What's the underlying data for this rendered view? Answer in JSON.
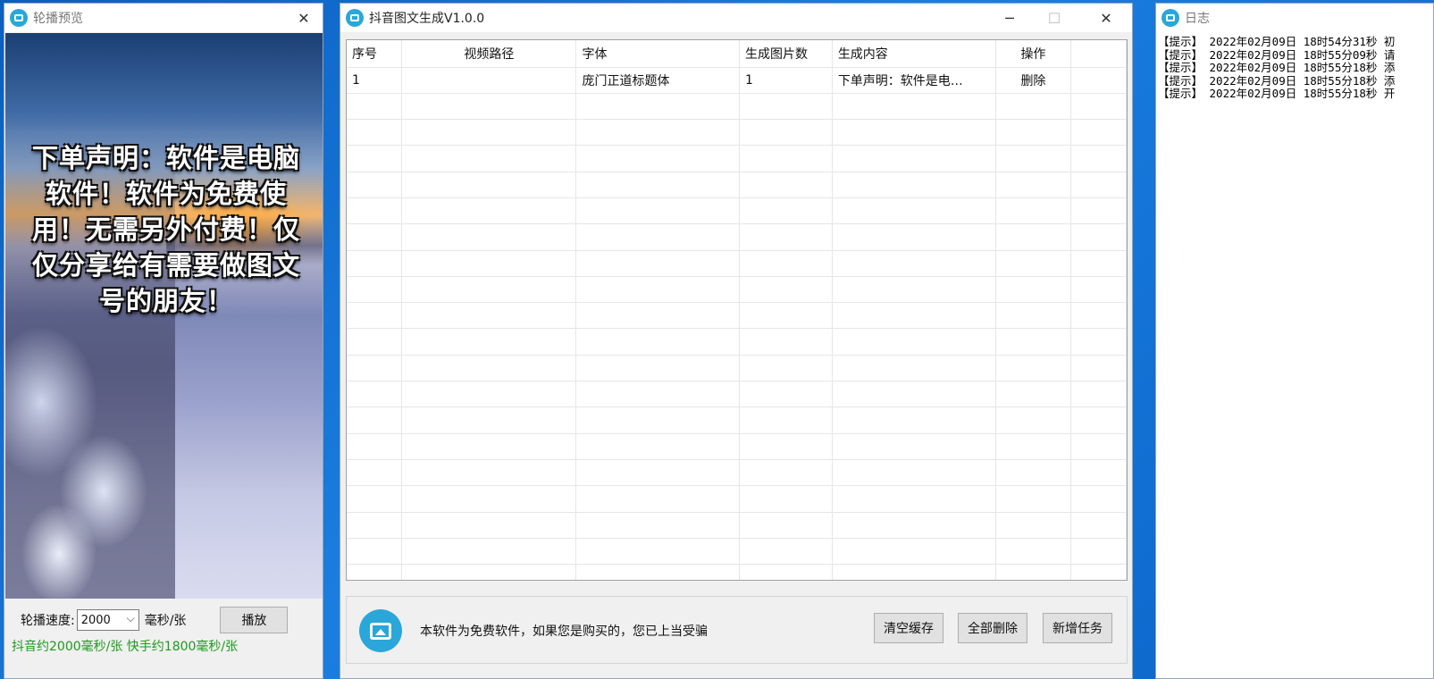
{
  "preview_window": {
    "title": "轮播预览",
    "close_glyph": "✕",
    "caption": "下单声明：软件是电脑软件！软件为免费使用！无需另外付费！仅仅分享给有需要做图文号的朋友！",
    "speed_label": "轮播速度:",
    "speed_value": "2000",
    "speed_unit": "毫秒/张",
    "play_label": "播放",
    "hint": "抖音约2000毫秒/张 快手约1800毫秒/张",
    "hint_color": "#1c9b1c"
  },
  "main_window": {
    "title": "抖音图文生成V1.0.0",
    "minimize_glyph": "─",
    "maximize_glyph": "☐",
    "close_glyph": "✕",
    "columns": [
      "序号",
      "视频路径",
      "字体",
      "生成图片数",
      "生成内容",
      "操作"
    ],
    "rows": [
      {
        "index": "1",
        "path": "",
        "font": "庞门正道标题体",
        "count": "1",
        "content": "下单声明：软件是电…",
        "action": "删除"
      }
    ],
    "notice": "本软件为免费软件，如果您是购买的，您已上当受骗",
    "buttons": {
      "clear_cache": "清空缓存",
      "delete_all": "全部删除",
      "add_task": "新增任务"
    }
  },
  "log_window": {
    "title": "日志",
    "lines": [
      "【提示】 2022年02月09日 18时54分31秒 初",
      "【提示】 2022年02月09日 18时55分09秒 请",
      "【提示】 2022年02月09日 18时55分18秒 添",
      "【提示】 2022年02月09日 18时55分18秒 添",
      "【提示】 2022年02月09日 18时55分18秒 开"
    ]
  },
  "colors": {
    "accent": "#2aa7d8",
    "desktop": "#0c6fd1"
  }
}
